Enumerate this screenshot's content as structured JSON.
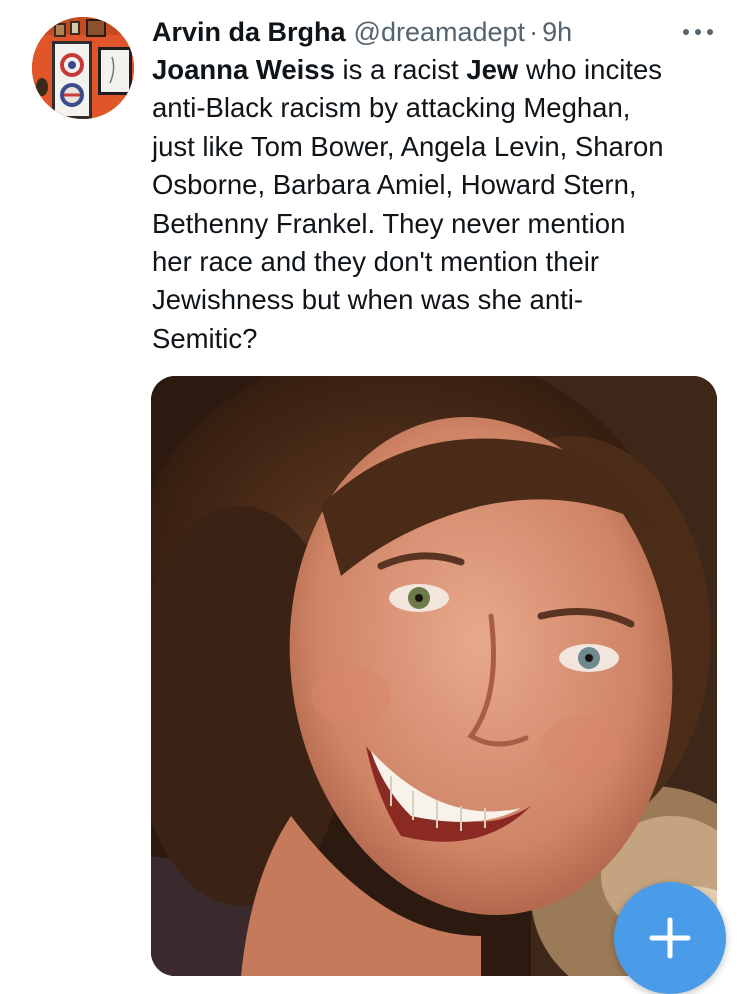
{
  "tweet": {
    "author": {
      "display_name": "Arvin da Brgha",
      "handle": "@dreamadept",
      "separator": "·",
      "timestamp": "9h"
    },
    "text_lines": [
      [
        {
          "t": "Joanna Weiss",
          "b": true
        },
        {
          "t": " is a racist ",
          "b": false
        },
        {
          "t": "Jew",
          "b": true
        },
        {
          "t": " who incites",
          "b": false
        }
      ],
      [
        {
          "t": "anti-Black racism by attacking Meghan,",
          "b": false
        }
      ],
      [
        {
          "t": "just like Tom Bower, Angela Levin, Sharon",
          "b": false
        }
      ],
      [
        {
          "t": "Osborne, Barbara Amiel, Howard Stern,",
          "b": false
        }
      ],
      [
        {
          "t": "Bethenny Frankel.  They never mention",
          "b": false
        }
      ],
      [
        {
          "t": "her race and they don't mention their",
          "b": false
        }
      ],
      [
        {
          "t": "Jewishness but when was she anti-",
          "b": false
        }
      ],
      [
        {
          "t": "Semitic?",
          "b": false
        }
      ]
    ],
    "more_icon": "more-horizontal-icon",
    "media_kind": "photo",
    "compose_icon": "plus-icon"
  },
  "colors": {
    "text": "#0f1419",
    "secondary": "#536471",
    "fab": "#4a9ce8",
    "avatar_wall": "#e0562a"
  }
}
